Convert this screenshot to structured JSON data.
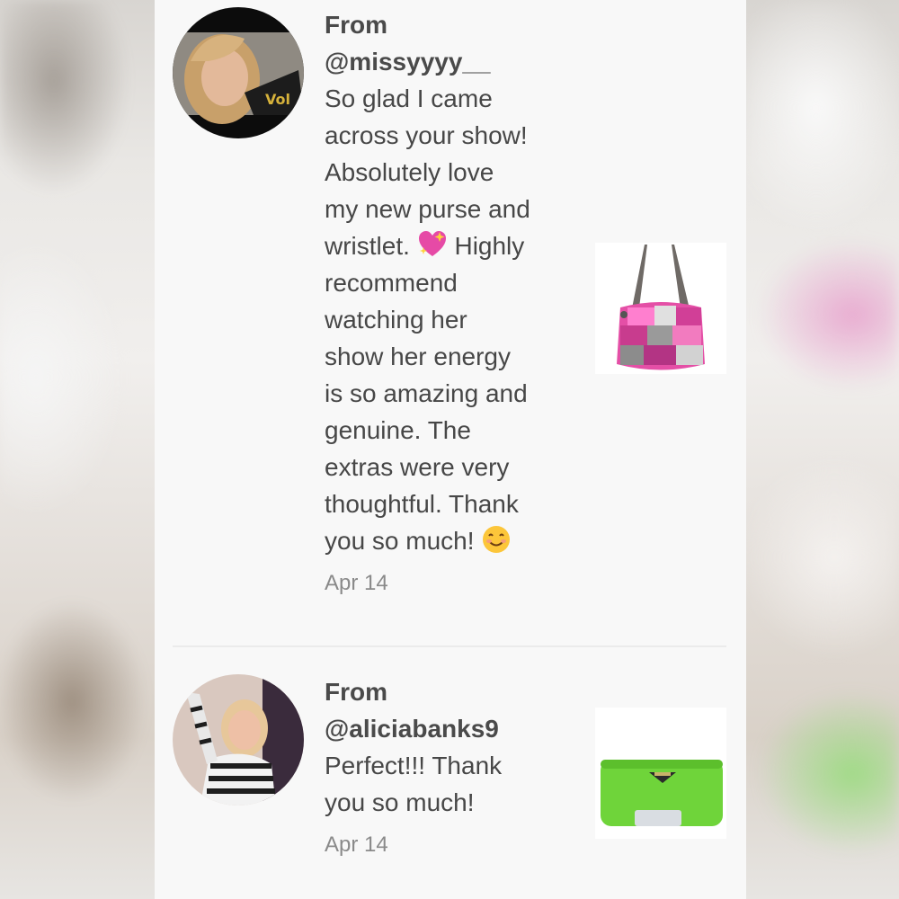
{
  "reviews": [
    {
      "from_label": "From",
      "handle": "@missyyyy__",
      "text_part1": "So glad I came\nacross your show!\nAbsolutely love\nmy new purse and\nwristlet. ",
      "emoji1": "sparkling-heart",
      "text_part2": " Highly\nrecommend\nwatching her\nshow her energy\nis so amazing and\ngenuine. The\nextras were very\nthoughtful. Thank\nyou so much! ",
      "emoji2": "smiling-face",
      "date": "Apr 14",
      "product": "pink patchwork shoulder purse"
    },
    {
      "from_label": "From",
      "handle": "@aliciabanks9",
      "text": "Perfect!!! Thank\nyou so much!",
      "date": "Apr 14",
      "product": "green zip wallet"
    }
  ],
  "colors": {
    "panel_bg": "#f8f8f8",
    "text": "#474747",
    "date": "#8a8a8a",
    "divider": "#ebebeb"
  }
}
